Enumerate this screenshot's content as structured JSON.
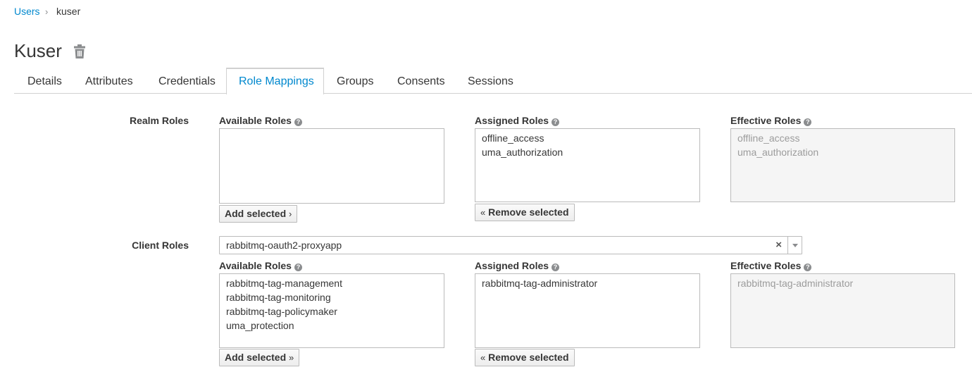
{
  "breadcrumb": {
    "parent": "Users",
    "separator": "›",
    "current": "kuser"
  },
  "page": {
    "title": "Kuser",
    "delete_icon": "trash-icon"
  },
  "tabs": [
    {
      "label": "Details"
    },
    {
      "label": "Attributes"
    },
    {
      "label": "Credentials"
    },
    {
      "label": "Role Mappings",
      "active": true
    },
    {
      "label": "Groups"
    },
    {
      "label": "Consents"
    },
    {
      "label": "Sessions"
    }
  ],
  "realm_roles": {
    "label": "Realm Roles",
    "available_heading": "Available Roles",
    "assigned_heading": "Assigned Roles",
    "effective_heading": "Effective Roles",
    "available": [],
    "assigned": [
      "offline_access",
      "uma_authorization"
    ],
    "effective": [
      "offline_access",
      "uma_authorization"
    ],
    "add_label": "Add selected",
    "add_chevron": "›",
    "remove_label": "Remove selected",
    "remove_chevron": "«"
  },
  "client_roles": {
    "label": "Client Roles",
    "client_select_value": "rabbitmq-oauth2-proxyapp",
    "clear_symbol": "×",
    "available_heading": "Available Roles",
    "assigned_heading": "Assigned Roles",
    "effective_heading": "Effective Roles",
    "available": [
      "rabbitmq-tag-management",
      "rabbitmq-tag-monitoring",
      "rabbitmq-tag-policymaker",
      "uma_protection"
    ],
    "assigned": [
      "rabbitmq-tag-administrator"
    ],
    "effective": [
      "rabbitmq-tag-administrator"
    ],
    "add_label": "Add selected",
    "add_chevron": "»",
    "remove_label": "Remove selected",
    "remove_chevron": "«"
  },
  "help_symbol": "?",
  "colors": {
    "link": "#0088ce",
    "text": "#363636",
    "border": "#bbbbbb",
    "readonly_bg": "#f5f5f5"
  }
}
